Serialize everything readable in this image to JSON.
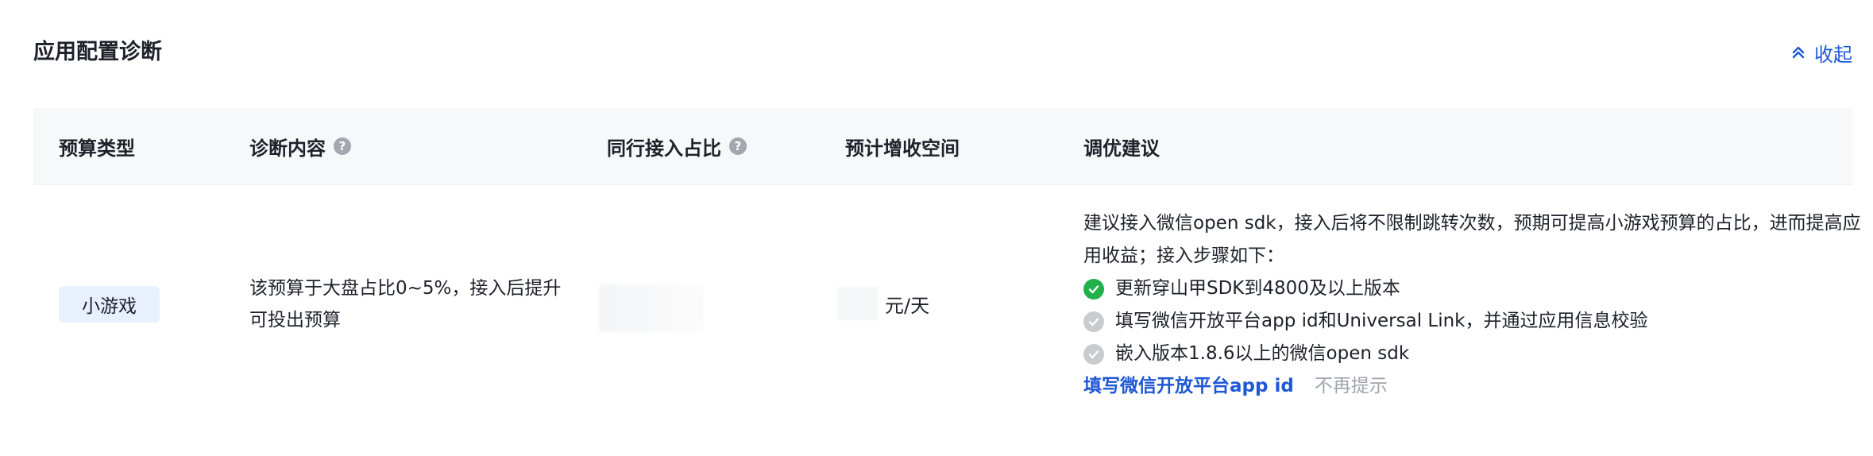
{
  "section": {
    "title": "应用配置诊断",
    "collapse_label": "收起"
  },
  "table": {
    "columns": [
      {
        "label": "预算类型",
        "has_help": false
      },
      {
        "label": "诊断内容",
        "has_help": true
      },
      {
        "label": "同行接入占比",
        "has_help": true
      },
      {
        "label": "预计增收空间",
        "has_help": false
      },
      {
        "label": "调优建议",
        "has_help": false
      }
    ],
    "row": {
      "budget_type": "小游戏",
      "diagnosis": "该预算于大盘占比0~5%，接入后提升可投出预算",
      "income_unit": "元/天",
      "advice": {
        "intro": "建议接入微信open sdk，接入后将不限制跳转次数，预期可提高小游戏预算的占比，进而提高应用收益；接入步骤如下：",
        "steps": [
          {
            "text": "更新穿山甲SDK到4800及以上版本",
            "status": "done"
          },
          {
            "text": "填写微信开放平台app id和Universal Link，并通过应用信息校验",
            "status": "todo"
          },
          {
            "text": "嵌入版本1.8.6以上的微信open sdk",
            "status": "todo"
          }
        ],
        "primary_action": "填写微信开放平台app id",
        "secondary_action": "不再提示"
      }
    }
  },
  "colors": {
    "accent": "#1f58d6",
    "success": "#21b04b",
    "pending": "#c9cbcf",
    "header_bg": "#f7f8fa",
    "tag_bg": "#e8effd"
  },
  "icons": {
    "collapse": "double-chevron-up-icon",
    "help": "question-circle-icon",
    "done": "check-circle-icon",
    "todo": "check-circle-gray-icon"
  }
}
